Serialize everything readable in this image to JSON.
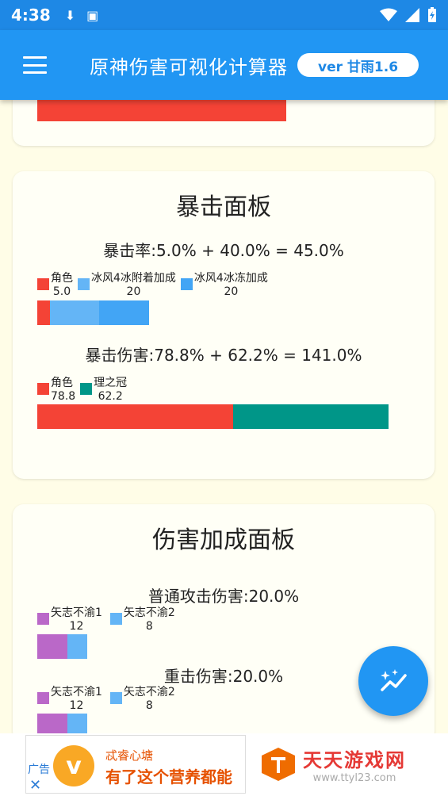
{
  "status_bar": {
    "time": "4:38"
  },
  "app_bar": {
    "title": "原神伤害可视化计算器",
    "version": "ver 甘雨1.6"
  },
  "colors": {
    "primary": "#2196F3",
    "red": "#F44336",
    "blue_light": "#64B5F6",
    "blue": "#42A5F5",
    "teal": "#009688",
    "purple": "#BA68C8",
    "background": "#FFFDE7"
  },
  "crit_panel": {
    "title": "暴击面板",
    "crit_rate": {
      "line": "暴击率:5.0% + 40.0% = 45.0%",
      "legend": [
        {
          "label": "角色",
          "value": "5.0"
        },
        {
          "label": "冰风4冰附着加成",
          "value": "20"
        },
        {
          "label": "冰风4冰冻加成",
          "value": "20"
        }
      ]
    },
    "crit_dmg": {
      "line": "暴击伤害:78.8% + 62.2% = 141.0%",
      "legend": [
        {
          "label": "角色",
          "value": "78.8"
        },
        {
          "label": "理之冠",
          "value": "62.2"
        }
      ]
    }
  },
  "dmg_bonus_panel": {
    "title": "伤害加成面板",
    "normal_attack": {
      "line": "普通攻击伤害:20.0%",
      "legend": [
        {
          "label": "矢志不渝1",
          "value": "12"
        },
        {
          "label": "矢志不渝2",
          "value": "8"
        }
      ]
    },
    "charged_attack": {
      "line": "重击伤害:20.0%",
      "legend": [
        {
          "label": "矢志不渝1",
          "value": "12"
        },
        {
          "label": "矢志不渝2",
          "value": "8"
        }
      ]
    }
  },
  "ad": {
    "label": "广告",
    "close": "✕",
    "logo_letter": "v",
    "name": "忒睿心塘",
    "slogan": "有了这个营养都能",
    "watermark_title": "天天游戏网",
    "watermark_url": "www.ttyl23.com"
  }
}
